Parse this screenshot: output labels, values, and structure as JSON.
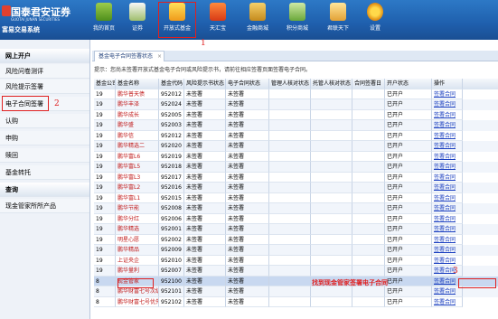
{
  "brand": {
    "name_cn": "国泰君安证券",
    "name_en": "GUOTAI JUNAN SECURITIES",
    "system": "富易交易系统"
  },
  "toolbar": [
    {
      "label": "我的首页",
      "icon": "home-icon"
    },
    {
      "label": "证券",
      "icon": "chart-icon"
    },
    {
      "label": "开放式基金",
      "icon": "fund-icon"
    },
    {
      "label": "天汇宝",
      "icon": "tianhuibao-icon"
    },
    {
      "label": "金融商城",
      "icon": "finance-mall-icon"
    },
    {
      "label": "积分商城",
      "icon": "points-mall-icon"
    },
    {
      "label": "君联天下",
      "icon": "junlian-icon"
    },
    {
      "label": "设置",
      "icon": "gear-icon"
    }
  ],
  "annotations": {
    "n1": "1",
    "n2": "2",
    "n3": "3",
    "callout": "找到现金管家签署电子合同"
  },
  "sidebar": [
    {
      "label": "网上开户",
      "group": true
    },
    {
      "label": "风险问卷测评",
      "group": false
    },
    {
      "label": "风险提示签署",
      "group": false
    },
    {
      "label": "电子合同签署",
      "group": false
    },
    {
      "label": "认购",
      "group": false
    },
    {
      "label": "申购",
      "group": false
    },
    {
      "label": "赎回",
      "group": false
    },
    {
      "label": "基金转托",
      "group": false
    },
    {
      "label": "查询",
      "group": true
    },
    {
      "label": "现金管家所所产品",
      "group": false
    }
  ],
  "main": {
    "tab_label": "基金电子合同签署状态",
    "notice": "提示：您尚未签署开放式基金电子合同或风险提示书，请前往相应签署页面签署电子合同。"
  },
  "table": {
    "columns": [
      "基金公司",
      "基金名称",
      "基金代码",
      "风险提示书状态",
      "电子合同状态",
      "管理人核对状态",
      "托管人核对状态",
      "合同签署日",
      "开户状态",
      "操作"
    ],
    "rows": [
      [
        "19",
        "鹏华普天债",
        "952012",
        "未签署",
        "未签署",
        "",
        "",
        "",
        "已开户",
        "签署合同"
      ],
      [
        "19",
        "鹏华丰泽",
        "952024",
        "未签署",
        "未签署",
        "",
        "",
        "",
        "已开户",
        "签署合同"
      ],
      [
        "19",
        "鹏华成长",
        "952005",
        "未签署",
        "未签署",
        "",
        "",
        "",
        "已开户",
        "签署合同"
      ],
      [
        "19",
        "鹏华盛",
        "952003",
        "未签署",
        "未签署",
        "",
        "",
        "",
        "已开户",
        "签署合同"
      ],
      [
        "19",
        "鹏华信",
        "952012",
        "未签署",
        "未签署",
        "",
        "",
        "",
        "已开户",
        "签署合同"
      ],
      [
        "19",
        "鹏华精选二",
        "952020",
        "未签署",
        "未签署",
        "",
        "",
        "",
        "已开户",
        "签署合同"
      ],
      [
        "19",
        "鹏华富L6",
        "952019",
        "未签署",
        "未签署",
        "",
        "",
        "",
        "已开户",
        "签署合同"
      ],
      [
        "19",
        "鹏华富L5",
        "952018",
        "未签署",
        "未签署",
        "",
        "",
        "",
        "已开户",
        "签署合同"
      ],
      [
        "19",
        "鹏华富L3",
        "952017",
        "未签署",
        "未签署",
        "",
        "",
        "",
        "已开户",
        "签署合同"
      ],
      [
        "19",
        "鹏华富L2",
        "952016",
        "未签署",
        "未签署",
        "",
        "",
        "",
        "已开户",
        "签署合同"
      ],
      [
        "19",
        "鹏华富L1",
        "952015",
        "未签署",
        "未签署",
        "",
        "",
        "",
        "已开户",
        "签署合同"
      ],
      [
        "19",
        "鹏华节能",
        "952008",
        "未签署",
        "未签署",
        "",
        "",
        "",
        "已开户",
        "签署合同"
      ],
      [
        "19",
        "鹏华分红",
        "952006",
        "未签署",
        "未签署",
        "",
        "",
        "",
        "已开户",
        "签署合同"
      ],
      [
        "19",
        "鹏华精选",
        "952001",
        "未签署",
        "未签署",
        "",
        "",
        "",
        "已开户",
        "签署合同"
      ],
      [
        "19",
        "明星心愿",
        "952002",
        "未签署",
        "未签署",
        "",
        "",
        "",
        "已开户",
        "签署合同"
      ],
      [
        "19",
        "鹏华精品",
        "952009",
        "未签署",
        "未签署",
        "",
        "",
        "",
        "已开户",
        "签署合同"
      ],
      [
        "19",
        "上证央企",
        "952010",
        "未签署",
        "未签署",
        "",
        "",
        "",
        "已开户",
        "签署合同"
      ],
      [
        "19",
        "鹏华量利",
        "952007",
        "未签署",
        "未签署",
        "",
        "",
        "",
        "已开户",
        "签署合同"
      ],
      [
        "8",
        "现金管家",
        "952100",
        "未签署",
        "未签署",
        "",
        "",
        "",
        "已开户",
        "签署合同"
      ],
      [
        "8",
        "鹏华财富七号次级",
        "952101",
        "未签署",
        "未签署",
        "",
        "",
        "",
        "已开户",
        "签署合同"
      ],
      [
        "8",
        "鹏华财富七号优先",
        "952102",
        "未签署",
        "未签署",
        "",
        "",
        "",
        "已开户",
        "签署合同"
      ]
    ]
  }
}
